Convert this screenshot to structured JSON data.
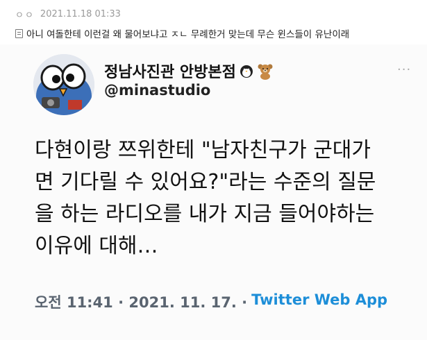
{
  "post": {
    "nickname": "ㅇㅇ",
    "datetime": "2021.11.18 01:33",
    "comment": "아니 여돌한테 이런걸 왜 물어보냐고 ㅈㄴ 무례한거 맞는데 무슨 윈스들이 유난이래"
  },
  "tweet": {
    "display_name": "정남사진관 안방본점",
    "handle": "@minastudio",
    "more": "···",
    "lines": [
      "다현이랑 쯔위한테 \"남자친구가 군대가",
      "면 기다릴 수 있어요?\"라는 수준의 질문",
      "을 하는 라디오를 내가 지금 들어야하는",
      "이유에 대해…"
    ],
    "time": "오전 11:41 · 2021. 11. 17. ·",
    "source": "Twitter Web App",
    "icons": [
      "penguin-icon",
      "teddy-bear-icon"
    ]
  },
  "colors": {
    "accent": "#1d8ed8",
    "meta_gray": "#9a9a9a",
    "tweet_bg": "#fbfbfb"
  }
}
